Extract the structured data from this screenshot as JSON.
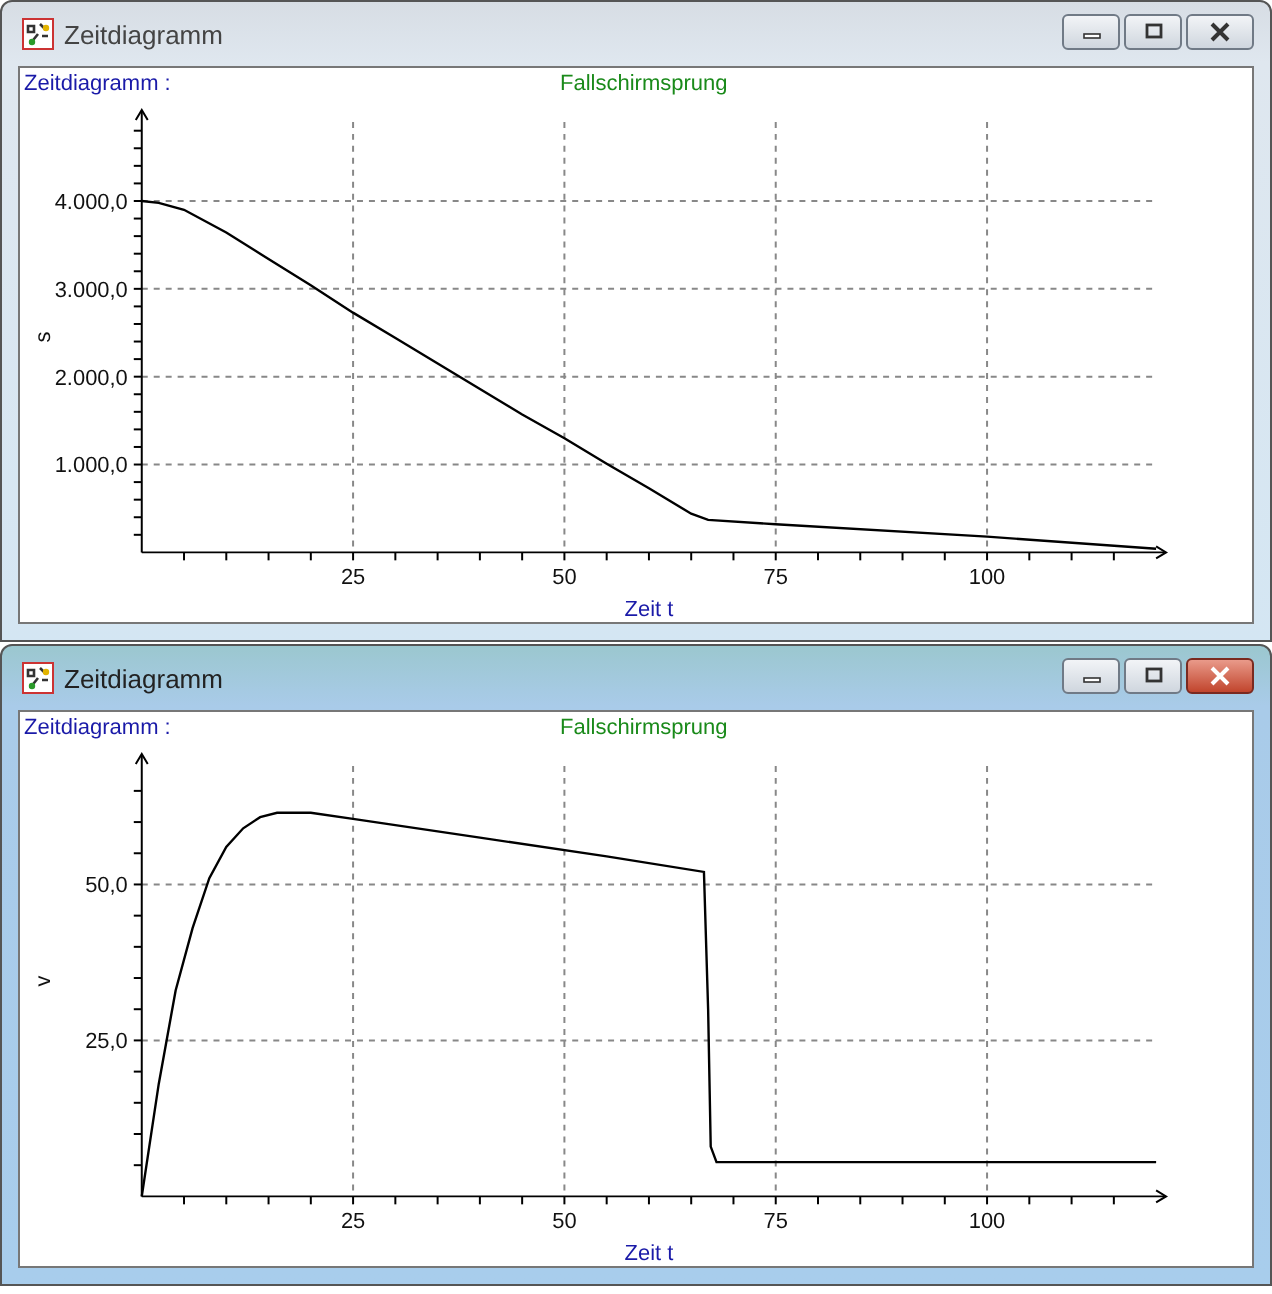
{
  "windows": [
    {
      "title": "Zeitdiagramm",
      "active": false,
      "header_label": "Zeitdiagramm :",
      "chart_data": {
        "type": "line",
        "title": "Fallschirmsprung",
        "xlabel": "Zeit t",
        "ylabel": "s",
        "xlim": [
          0,
          120
        ],
        "ylim": [
          0,
          4900
        ],
        "xticks": [
          25,
          50,
          75,
          100
        ],
        "yticks": [
          {
            "value": 1000,
            "label": "1.000,0"
          },
          {
            "value": 2000,
            "label": "2.000,0"
          },
          {
            "value": 3000,
            "label": "3.000,0"
          },
          {
            "value": 4000,
            "label": "4.000,0"
          }
        ],
        "x": [
          0,
          2,
          5,
          10,
          15,
          20,
          25,
          30,
          35,
          40,
          45,
          50,
          55,
          60,
          65,
          67,
          75,
          100,
          120
        ],
        "grid": true,
        "series": [
          {
            "color": "#000000",
            "values": [
              4000,
              3980,
              3900,
              3640,
              3340,
              3040,
              2730,
              2440,
              2150,
              1860,
              1570,
              1300,
              1010,
              730,
              440,
              370,
              320,
              180,
              40
            ]
          }
        ]
      }
    },
    {
      "title": "Zeitdiagramm",
      "active": true,
      "header_label": "Zeitdiagramm :",
      "chart_data": {
        "type": "line",
        "title": "Fallschirmsprung",
        "xlabel": "Zeit t",
        "ylabel": "v",
        "xlim": [
          0,
          120
        ],
        "ylim": [
          0,
          69
        ],
        "xticks": [
          25,
          50,
          75,
          100
        ],
        "yticks": [
          {
            "value": 25,
            "label": "25,0"
          },
          {
            "value": 50,
            "label": "50,0"
          }
        ],
        "x": [
          0,
          2,
          4,
          6,
          8,
          10,
          12,
          14,
          16,
          20,
          25,
          40,
          55,
          66.5,
          67,
          67.3,
          68,
          120
        ],
        "grid": true,
        "series": [
          {
            "color": "#000000",
            "values": [
              0,
              18,
              33,
              43,
              51,
              56,
              59,
              60.8,
              61.5,
              61.5,
              60.5,
              57.5,
              54.5,
              52,
              30,
              8,
              5.5,
              5.5
            ]
          }
        ]
      }
    }
  ]
}
